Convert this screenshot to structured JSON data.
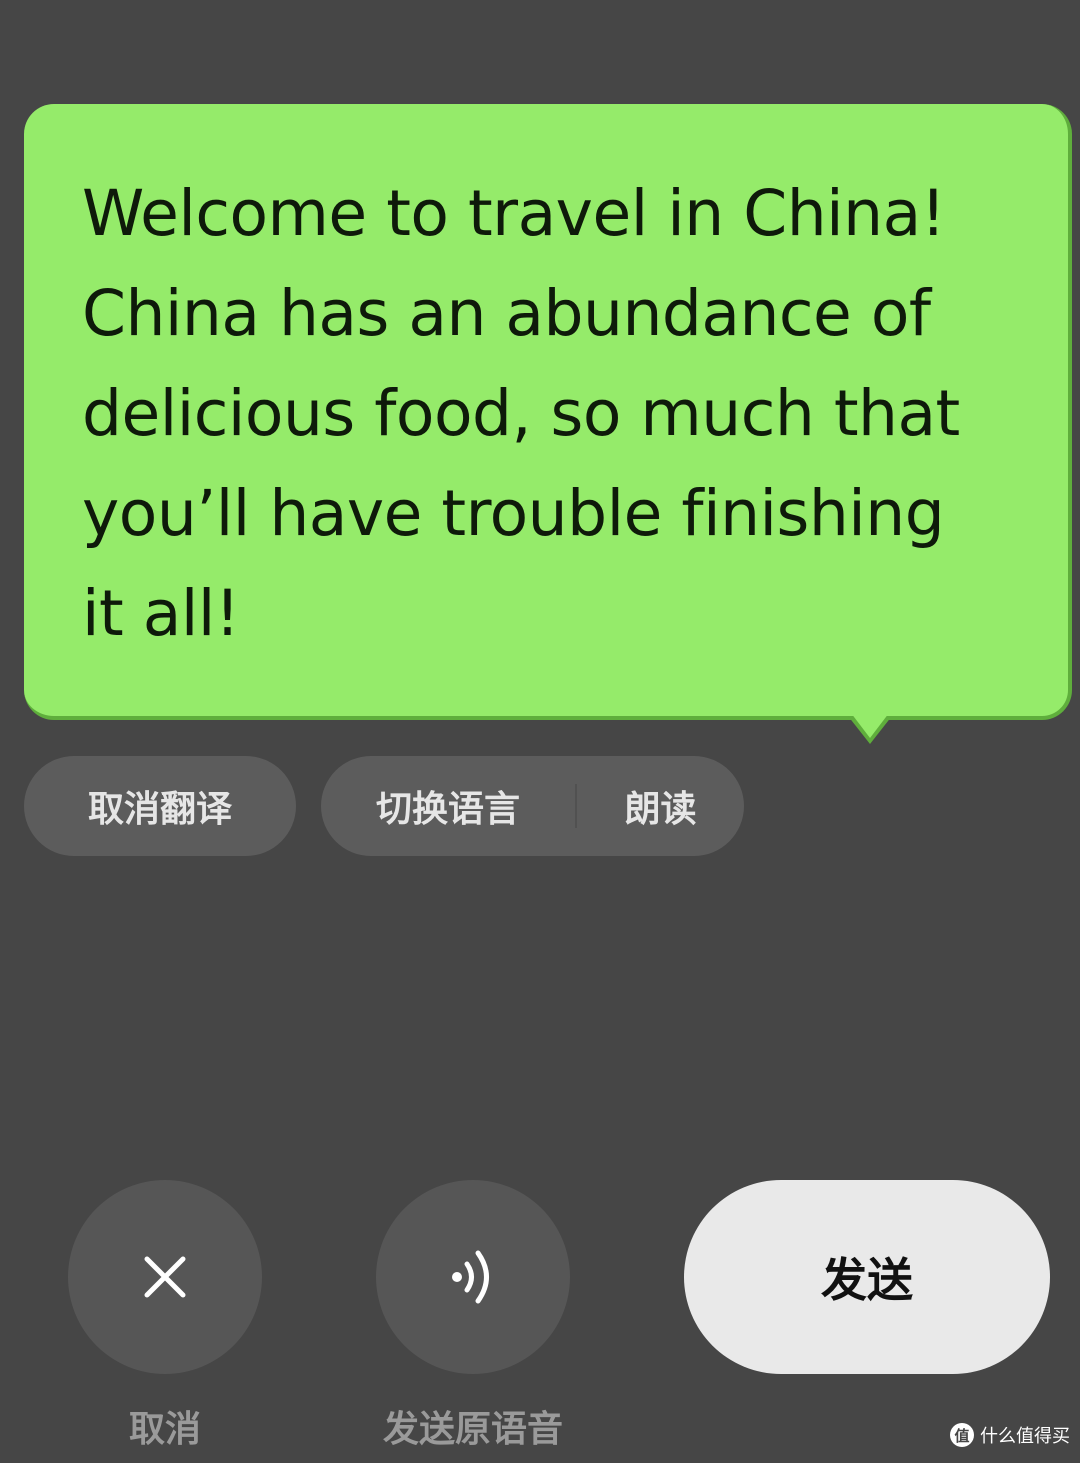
{
  "bubble": {
    "text": "Welcome to travel in China!\nChina has an abundance of\ndelicious food, so much that\nyou’ll have trouble finishing\nit all!"
  },
  "actions": {
    "cancel_translation": "取消翻译",
    "switch_language": "切换语言",
    "read_aloud": "朗读"
  },
  "bottom": {
    "cancel_label": "取消",
    "send_original_voice_label": "发送原语音",
    "send_label": "发送"
  },
  "watermark": {
    "badge": "值",
    "text": "什么值得买"
  },
  "colors": {
    "background": "#464646",
    "bubble": "#95eb6a",
    "chip": "#5c5c5c",
    "send_button": "#e9e9e9"
  },
  "icons": [
    "close-icon",
    "speaker-icon"
  ]
}
